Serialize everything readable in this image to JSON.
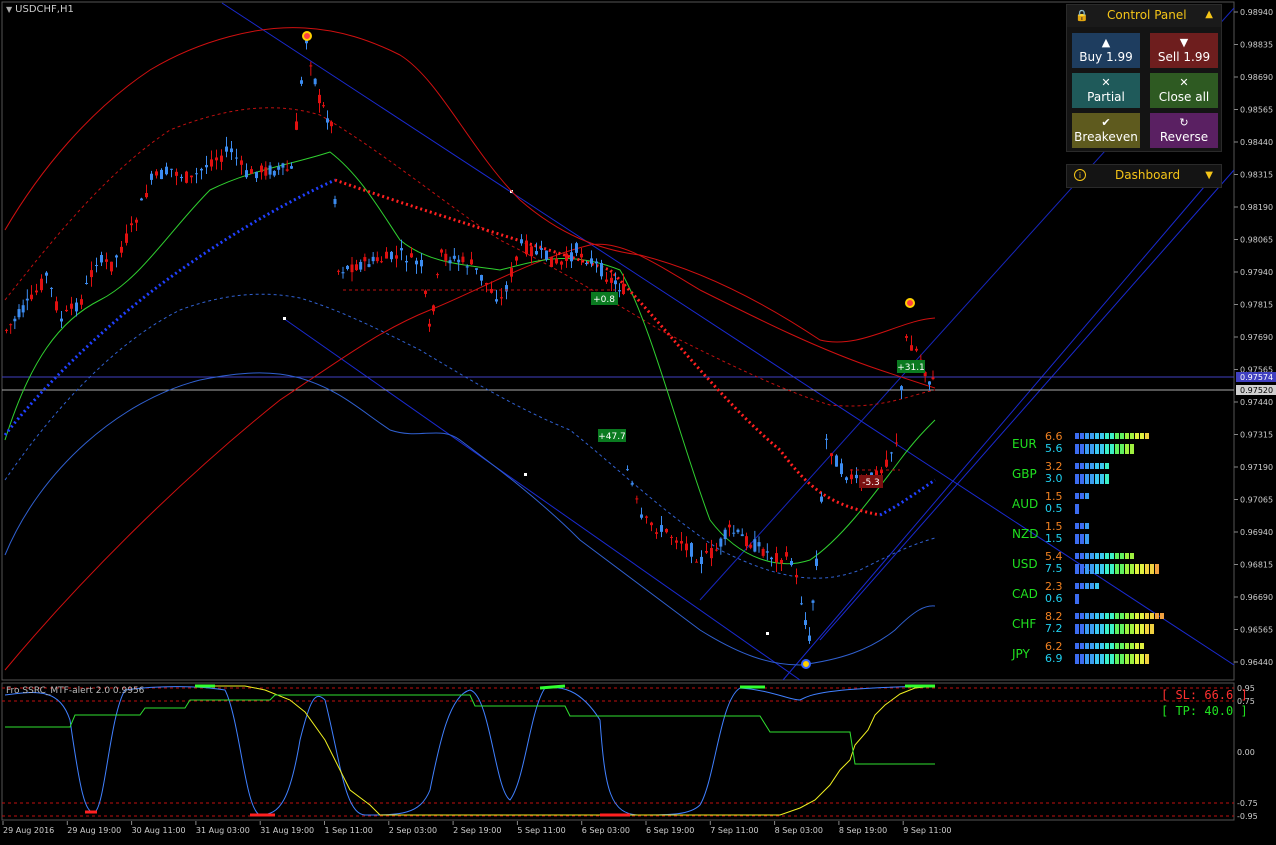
{
  "chart": {
    "symbol": "USDCHF,H1",
    "indicator_label": "Fro SSRC_MTF-alert 2.0 0.9956",
    "price_axis": [
      "0.98940",
      "0.98835",
      "0.98690",
      "0.98565",
      "0.98440",
      "0.98315",
      "0.98190",
      "0.98065",
      "0.97940",
      "0.97815",
      "0.97690",
      "0.97565",
      "0.97440",
      "0.97315",
      "0.97190",
      "0.97065",
      "0.96940",
      "0.96815",
      "0.96690",
      "0.96565",
      "0.96440"
    ],
    "current_price_labels": [
      "0.97574",
      "0.97520"
    ],
    "time_axis": [
      "29 Aug 2016",
      "29 Aug 19:00",
      "30 Aug 11:00",
      "31 Aug 03:00",
      "31 Aug 19:00",
      "1 Sep 11:00",
      "2 Sep 03:00",
      "2 Sep 19:00",
      "5 Sep 11:00",
      "6 Sep 03:00",
      "6 Sep 19:00",
      "7 Sep 11:00",
      "8 Sep 03:00",
      "8 Sep 19:00",
      "9 Sep 11:00"
    ],
    "sub_axis": [
      "0.95",
      "0.75",
      "0.00",
      "-0.75",
      "-0.95"
    ],
    "trade_labels": [
      "+0.8",
      "+47.7",
      "+31.1",
      "-5.3"
    ],
    "sl_label": "[ SL: 66.6 ]",
    "tp_label": "[ TP: 40.0 ]",
    "colors": {
      "bull": "#3c8cf0",
      "bear": "#e01010",
      "channel": "#1020c0",
      "band": "#d01010",
      "ma": "#40e040",
      "mid": "#2050f0",
      "osc": "#4080ff",
      "trend": "#ffff40"
    }
  },
  "control_panel": {
    "title": "Control Panel",
    "lock_icon": "lock-icon",
    "buy_label": "Buy 1.99",
    "sell_label": "Sell 1.99",
    "partial_label": "Partial",
    "closeall_label": "Close all",
    "breakeven_label": "Breakeven",
    "reverse_label": "Reverse",
    "dashboard_label": "Dashboard"
  },
  "strength": [
    {
      "cur": "EUR",
      "a": "6.6",
      "b": "5.6"
    },
    {
      "cur": "GBP",
      "a": "3.2",
      "b": "3.0"
    },
    {
      "cur": "AUD",
      "a": "1.5",
      "b": "0.5"
    },
    {
      "cur": "NZD",
      "a": "1.5",
      "b": "1.5"
    },
    {
      "cur": "USD",
      "a": "5.4",
      "b": "7.5"
    },
    {
      "cur": "CAD",
      "a": "2.3",
      "b": "0.6"
    },
    {
      "cur": "CHF",
      "a": "8.2",
      "b": "7.2"
    },
    {
      "cur": "JPY",
      "a": "6.2",
      "b": "6.9"
    }
  ]
}
